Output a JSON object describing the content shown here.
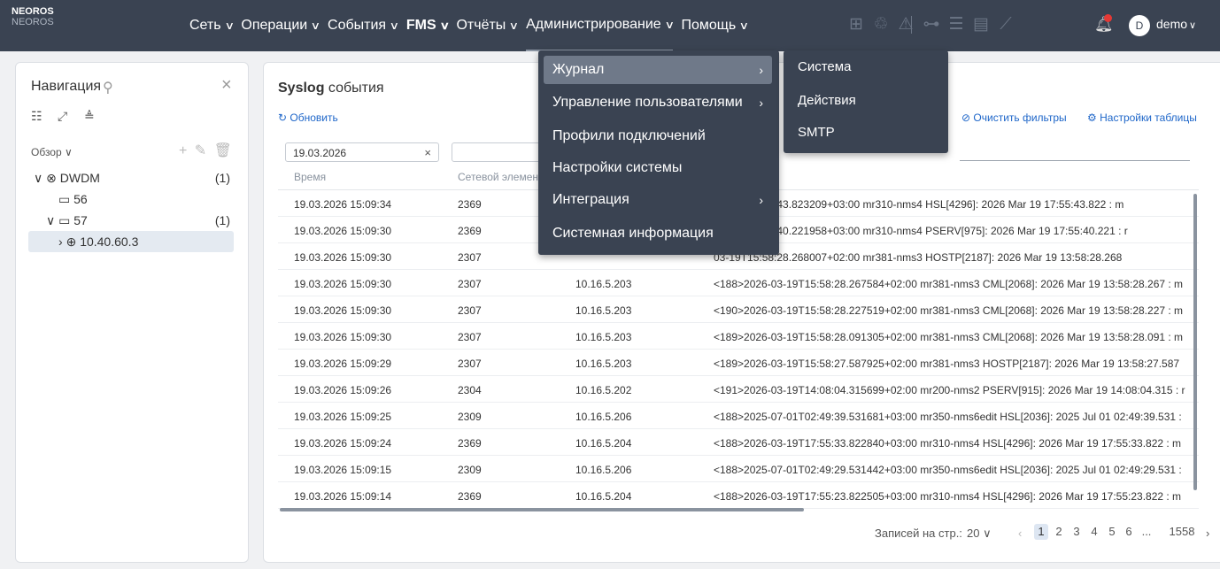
{
  "brand": {
    "line1": "NEOROS",
    "line2": "NEOROS"
  },
  "menu": [
    {
      "label": "Сеть"
    },
    {
      "label": "Операции"
    },
    {
      "label": "События"
    },
    {
      "label": "FMS"
    },
    {
      "label": "Отчёты"
    },
    {
      "label": "Администрирование"
    },
    {
      "label": "Помощь"
    }
  ],
  "user": {
    "initial": "D",
    "name": "demo"
  },
  "nav": {
    "title": "Навигация",
    "overview_label": "Обзор",
    "tree": [
      {
        "label": "DWDM",
        "count": "(1)"
      },
      {
        "label": "56",
        "count": ""
      },
      {
        "label": "57",
        "count": "(1)"
      },
      {
        "label": "10.40.60.3",
        "count": ""
      }
    ]
  },
  "main": {
    "title_bold": "Syslog",
    "title_rest": " события",
    "refresh_label": "Обновить",
    "clear_filters_label": "Очистить фильтры",
    "table_settings_label": "Настройки таблицы",
    "date_filter_value": "19.03.2026",
    "columns": [
      "Время",
      "Сетевой элемен"
    ],
    "rows": [
      {
        "time": "19.03.2026 15:09:34",
        "ne": "2369",
        "ip": "",
        "msg": "03-19T17:55:43.823209+03:00 mr310-nms4 HSL[4296]: 2026 Mar 19 17:55:43.822 : m"
      },
      {
        "time": "19.03.2026 15:09:30",
        "ne": "2369",
        "ip": "",
        "msg": "03-19T17:55:40.221958+03:00 mr310-nms4 PSERV[975]: 2026 Mar 19 17:55:40.221 : r"
      },
      {
        "time": "19.03.2026 15:09:30",
        "ne": "2307",
        "ip": "",
        "msg": "03-19T15:58:28.268007+02:00 mr381-nms3 HOSTP[2187]: 2026 Mar 19 13:58:28.268"
      },
      {
        "time": "19.03.2026 15:09:30",
        "ne": "2307",
        "ip": "10.16.5.203",
        "msg": "<188>2026-03-19T15:58:28.267584+02:00 mr381-nms3 CML[2068]: 2026 Mar 19 13:58:28.267 : m"
      },
      {
        "time": "19.03.2026 15:09:30",
        "ne": "2307",
        "ip": "10.16.5.203",
        "msg": "<190>2026-03-19T15:58:28.227519+02:00 mr381-nms3 CML[2068]: 2026 Mar 19 13:58:28.227 : m"
      },
      {
        "time": "19.03.2026 15:09:30",
        "ne": "2307",
        "ip": "10.16.5.203",
        "msg": "<189>2026-03-19T15:58:28.091305+02:00 mr381-nms3 CML[2068]: 2026 Mar 19 13:58:28.091 : m"
      },
      {
        "time": "19.03.2026 15:09:29",
        "ne": "2307",
        "ip": "10.16.5.203",
        "msg": "<189>2026-03-19T15:58:27.587925+02:00 mr381-nms3 HOSTP[2187]: 2026 Mar 19 13:58:27.587"
      },
      {
        "time": "19.03.2026 15:09:26",
        "ne": "2304",
        "ip": "10.16.5.202",
        "msg": "<191>2026-03-19T14:08:04.315699+02:00 mr200-nms2 PSERV[915]: 2026 Mar 19 14:08:04.315 : r"
      },
      {
        "time": "19.03.2026 15:09:25",
        "ne": "2309",
        "ip": "10.16.5.206",
        "msg": "<188>2025-07-01T02:49:39.531681+03:00 mr350-nms6edit HSL[2036]: 2025 Jul 01 02:49:39.531 :"
      },
      {
        "time": "19.03.2026 15:09:24",
        "ne": "2369",
        "ip": "10.16.5.204",
        "msg": "<188>2026-03-19T17:55:33.822840+03:00 mr310-nms4 HSL[4296]: 2026 Mar 19 17:55:33.822 : m"
      },
      {
        "time": "19.03.2026 15:09:15",
        "ne": "2309",
        "ip": "10.16.5.206",
        "msg": "<188>2025-07-01T02:49:29.531442+03:00 mr350-nms6edit HSL[2036]: 2025 Jul 01 02:49:29.531 :"
      },
      {
        "time": "19.03.2026 15:09:14",
        "ne": "2369",
        "ip": "10.16.5.204",
        "msg": "<188>2026-03-19T17:55:23.822505+03:00 mr310-nms4 HSL[4296]: 2026 Mar 19 17:55:23.822 : m"
      }
    ],
    "pager": {
      "records_label": "Записей на стр.:",
      "per_page": "20",
      "pages": [
        "1",
        "2",
        "3",
        "4",
        "5",
        "6",
        "...",
        "1558"
      ],
      "current": "1"
    }
  },
  "admin_menu": {
    "items": [
      {
        "label": "Журнал",
        "has_sub": true
      },
      {
        "label": "Управление пользователями",
        "has_sub": true
      },
      {
        "label": "Профили подключений",
        "has_sub": false
      },
      {
        "label": "Настройки системы",
        "has_sub": false
      },
      {
        "label": "Интеграция",
        "has_sub": true
      },
      {
        "label": "Системная информация",
        "has_sub": false
      }
    ],
    "submenu": [
      "Система",
      "Действия",
      "SMTP"
    ]
  }
}
